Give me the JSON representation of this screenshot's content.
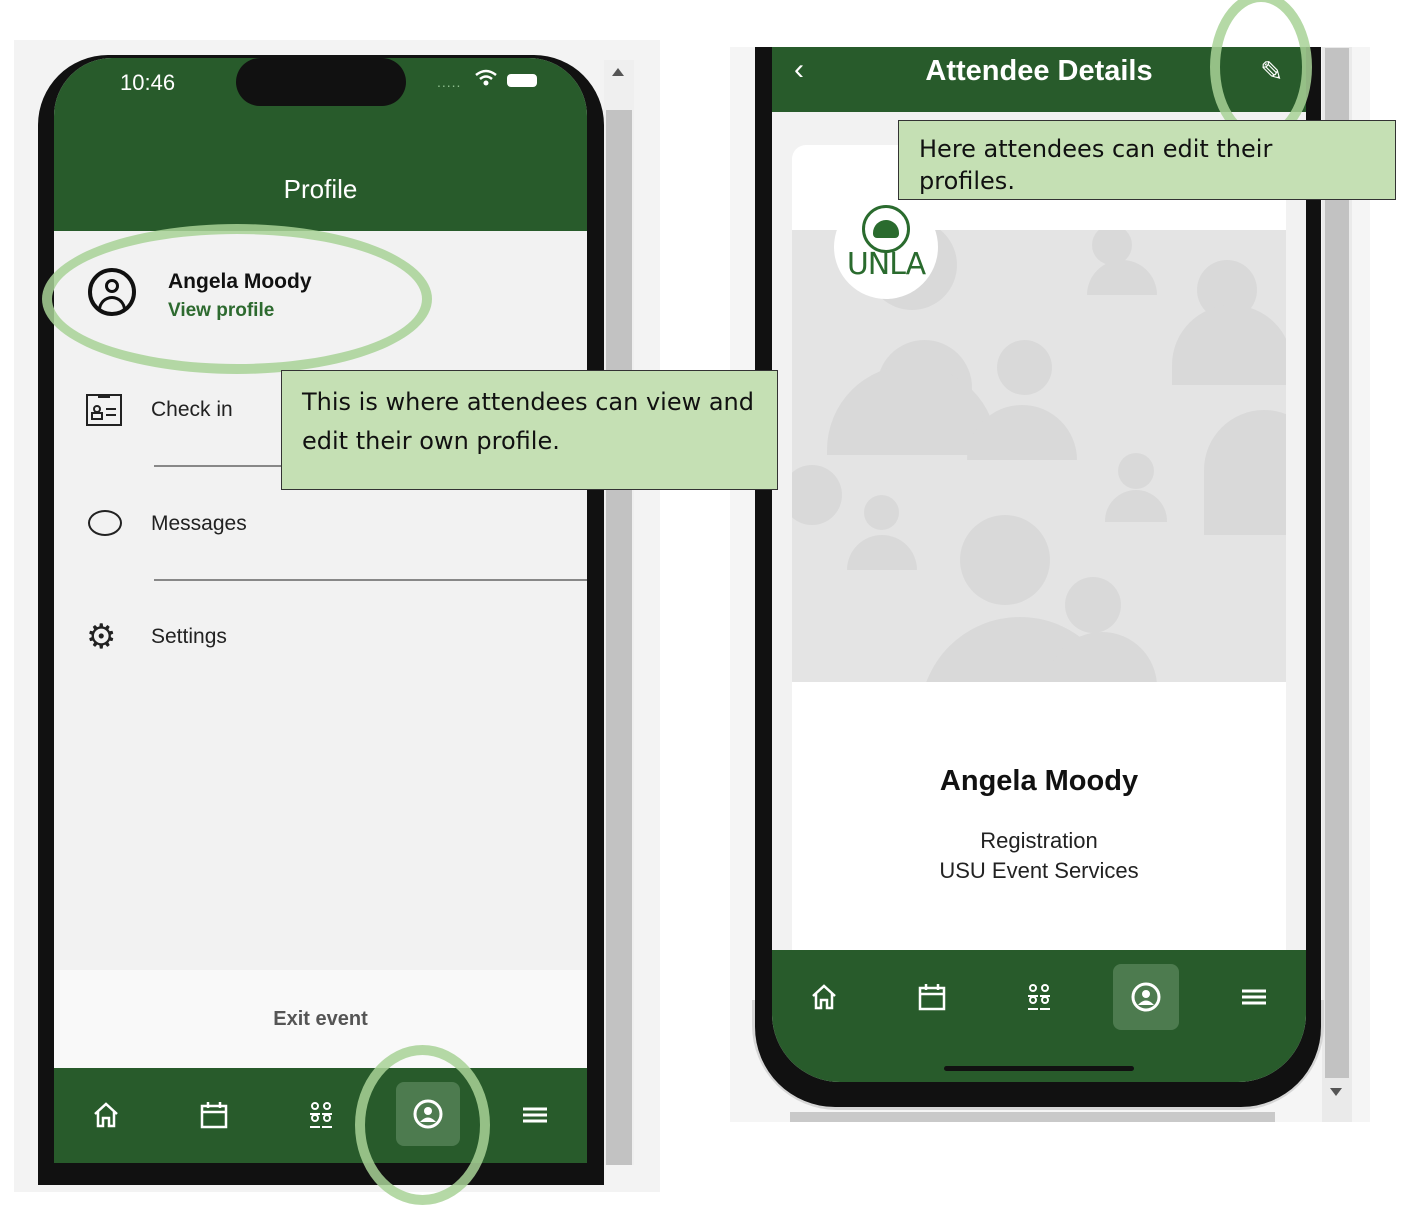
{
  "left_screen": {
    "status_time": "10:46",
    "status_dots": ".....",
    "title": "Profile",
    "profile": {
      "name": "Angela Moody",
      "link_label": "View profile"
    },
    "menu": [
      {
        "label": "Check in",
        "icon": "id-badge-icon"
      },
      {
        "label": "Messages",
        "icon": "chat-bubble-icon"
      },
      {
        "label": "Settings",
        "icon": "gear-icon"
      }
    ],
    "exit_label": "Exit event",
    "tabs": [
      {
        "icon": "home-icon",
        "glyph": "⌂"
      },
      {
        "icon": "calendar-icon",
        "glyph": "📅"
      },
      {
        "icon": "people-icon",
        "glyph": "ஃ"
      },
      {
        "icon": "profile-icon",
        "glyph": "◉",
        "active": true
      },
      {
        "icon": "menu-icon",
        "glyph": "≡"
      }
    ]
  },
  "right_screen": {
    "title": "Attendee Details",
    "back_glyph": "‹",
    "edit_glyph": "✎",
    "logo_text": "UNLA",
    "attendee": {
      "name": "Angela Moody",
      "role": "Registration",
      "organization": "USU Event Services"
    }
  },
  "callouts": {
    "left": "This is where attendees can view and edit their own profile.",
    "right": "Here attendees can edit their profiles."
  },
  "colors": {
    "brand_green": "#285b2b",
    "callout_fill": "#c5e0b4",
    "highlight_ring": "#a8d296"
  }
}
